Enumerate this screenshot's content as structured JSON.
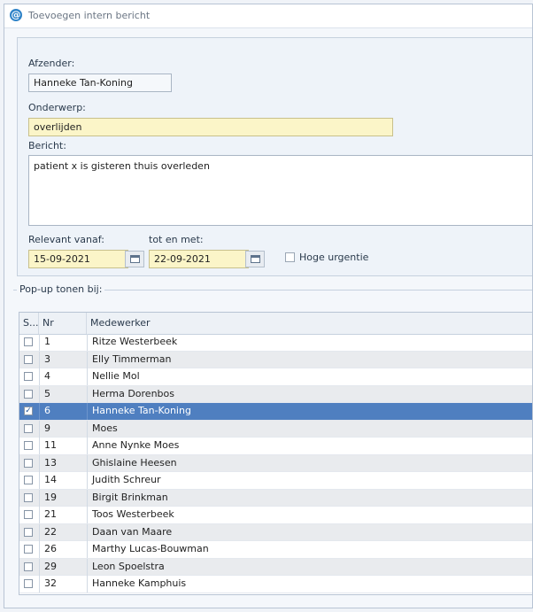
{
  "window": {
    "title": "Toevoegen intern bericht",
    "icon": "at-sign-icon"
  },
  "form": {
    "sender_label": "Afzender:",
    "sender_value": "Hanneke Tan-Koning",
    "subject_label": "Onderwerp:",
    "subject_value": "overlijden",
    "message_label": "Bericht:",
    "message_value": "patient x is gisteren thuis overleden",
    "relevant_from_label": "Relevant vanaf:",
    "relevant_from_value": "15-09-2021",
    "until_label": "tot en met:",
    "until_value": "22-09-2021",
    "urgency_label": "Hoge urgentie",
    "urgency_checked": false
  },
  "popup": {
    "group_label": "Pop-up tonen bij:",
    "columns": [
      "S...",
      "Nr",
      "Medewerker"
    ],
    "rows": [
      {
        "checked": false,
        "nr": "1",
        "name": "Ritze Westerbeek"
      },
      {
        "checked": false,
        "nr": "3",
        "name": "Elly Timmerman"
      },
      {
        "checked": false,
        "nr": "4",
        "name": "Nellie Mol"
      },
      {
        "checked": false,
        "nr": "5",
        "name": "Herma Dorenbos"
      },
      {
        "checked": true,
        "nr": "6",
        "name": "Hanneke Tan-Koning",
        "selected": true
      },
      {
        "checked": false,
        "nr": "9",
        "name": "Moes"
      },
      {
        "checked": false,
        "nr": "11",
        "name": "Anne Nynke Moes"
      },
      {
        "checked": false,
        "nr": "13",
        "name": "Ghislaine Heesen"
      },
      {
        "checked": false,
        "nr": "14",
        "name": "Judith Schreur"
      },
      {
        "checked": false,
        "nr": "19",
        "name": "Birgit Brinkman"
      },
      {
        "checked": false,
        "nr": "21",
        "name": "Toos Westerbeek"
      },
      {
        "checked": false,
        "nr": "22",
        "name": "Daan van Maare"
      },
      {
        "checked": false,
        "nr": "26",
        "name": "Marthy Lucas-Bouwman"
      },
      {
        "checked": false,
        "nr": "29",
        "name": "Leon Spoelstra"
      },
      {
        "checked": false,
        "nr": "32",
        "name": "Hanneke Kamphuis"
      }
    ]
  },
  "colors": {
    "selection": "#4f7fc0",
    "required_field": "#fbf5c8",
    "accent": "#2f83c8"
  }
}
